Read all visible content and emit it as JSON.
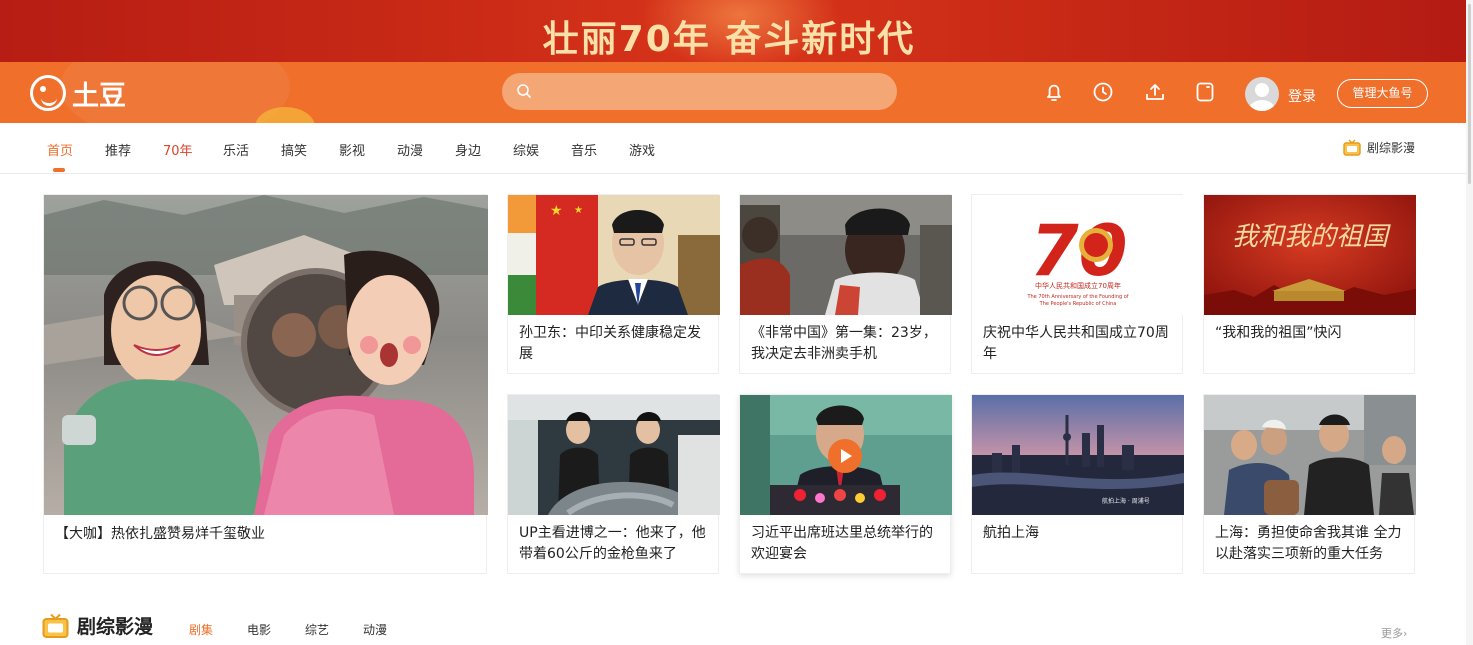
{
  "banner": {
    "text": "壮丽70年  奋斗新时代"
  },
  "header": {
    "logo_text": "土豆",
    "search_placeholder": "",
    "login_label": "登录",
    "manage_label": "管理大鱼号",
    "icons": [
      "bell-icon",
      "clock-icon",
      "upload-icon",
      "phone-icon"
    ]
  },
  "nav": {
    "items": [
      "首页",
      "推荐",
      "70年",
      "乐活",
      "搞笑",
      "影视",
      "动漫",
      "身边",
      "综娱",
      "音乐",
      "游戏"
    ],
    "right_label": "剧综影漫"
  },
  "feature": {
    "caption": "【大咖】热依扎盛赞易烊千玺敬业"
  },
  "cards": [
    {
      "caption": "孙卫东：中印关系健康稳定发展"
    },
    {
      "caption": "《非常中国》第一集：23岁，我决定去非洲卖手机"
    },
    {
      "caption": "庆祝中华人民共和国成立70周年"
    },
    {
      "caption": "“我和我的祖国”快闪"
    },
    {
      "caption": "UP主看进博之一：他来了，他带着60公斤的金枪鱼来了"
    },
    {
      "caption": "习近平出席班达里总统举行的欢迎宴会"
    },
    {
      "caption": "航拍上海"
    },
    {
      "caption": "上海：勇担使命舍我其谁 全力以赴落实三项新的重大任务"
    }
  ],
  "thumb_text": {
    "c3_big": "70",
    "c3_small1": "中华人民共和国成立70周年",
    "c3_small2": "The 70th Anniversary of the Founding of",
    "c3_small3": "The People's Republic of China",
    "c4_title": "我和我的祖国",
    "c7_small": "航拍上海 · 周浦号"
  },
  "section": {
    "title": "剧综影漫",
    "tabs": [
      "剧集",
      "电影",
      "综艺",
      "动漫"
    ],
    "more_label": "更多"
  },
  "colors": {
    "accent": "#ef6f2b",
    "banner": "#c92a16",
    "banner_text": "#fbe0a8"
  }
}
